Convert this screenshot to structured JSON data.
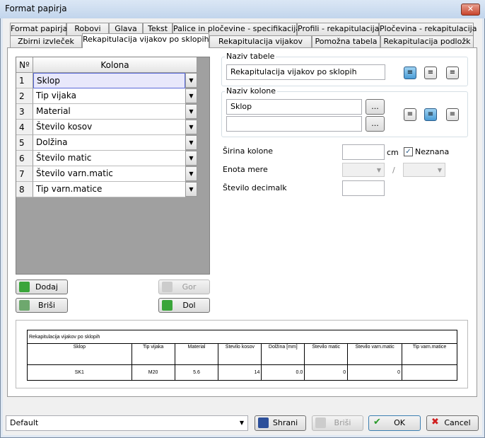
{
  "window": {
    "title": "Format papirja",
    "close_icon": "close-icon"
  },
  "tabs_row1": [
    "Format papirja",
    "Robovi",
    "Glava",
    "Tekst",
    "Palice in pločevine - specifikacija",
    "Profili - rekapitulacija",
    "Pločevina - rekapitulacija"
  ],
  "tabs_row2": [
    "Zbirni izvleček",
    "Rekapitulacija vijakov po sklopih",
    "Rekapitulacija vijakov",
    "Pomožna tabela",
    "Rekapitulacija podložk"
  ],
  "active_tab": "Rekapitulacija vijakov po sklopih",
  "grid": {
    "col_no": "Nº",
    "col_kolona": "Kolona",
    "rows": [
      {
        "n": "1",
        "v": "Sklop"
      },
      {
        "n": "2",
        "v": "Tip vijaka"
      },
      {
        "n": "3",
        "v": "Material"
      },
      {
        "n": "4",
        "v": "Število kosov"
      },
      {
        "n": "5",
        "v": "Dolžina"
      },
      {
        "n": "6",
        "v": "Število matic"
      },
      {
        "n": "7",
        "v": "Število varn.matic"
      },
      {
        "n": "8",
        "v": "Tip varn.matice"
      }
    ]
  },
  "buttons": {
    "dodaj": "Dodaj",
    "brisi": "Briši",
    "gor": "Gor",
    "dol": "Dol"
  },
  "naziv_tabele": {
    "label": "Naziv tabele",
    "value": "Rekapitulacija vijakov po sklopih",
    "align": "left"
  },
  "naziv_kolone": {
    "label": "Naziv kolone",
    "value1": "Sklop",
    "value2": "",
    "more": "...",
    "align": "center"
  },
  "sirina": {
    "label": "Širina kolone",
    "unit": "cm",
    "neznana": "Neznana",
    "checked": true
  },
  "enota": {
    "label": "Enota mere",
    "sep": "/"
  },
  "decimalk": {
    "label": "Število decimalk"
  },
  "preview": {
    "title": "Rekapitulacija vijakov po sklopih",
    "headers": [
      "Sklop",
      "Tip vijaka",
      "Material",
      "Število kosov",
      "Dolžina [mm]",
      "Število matic",
      "Število varn.matic",
      "Tip varn.matice"
    ],
    "row": [
      "SK1",
      "M20",
      "5.6",
      "14",
      "0.0",
      "0",
      "0",
      ""
    ]
  },
  "footer": {
    "preset": "Default",
    "shrani": "Shrani",
    "brisi": "Briši",
    "ok": "OK",
    "cancel": "Cancel"
  },
  "colors": {
    "accent": "#4a9cd6",
    "selection": "#e8e8fb"
  }
}
